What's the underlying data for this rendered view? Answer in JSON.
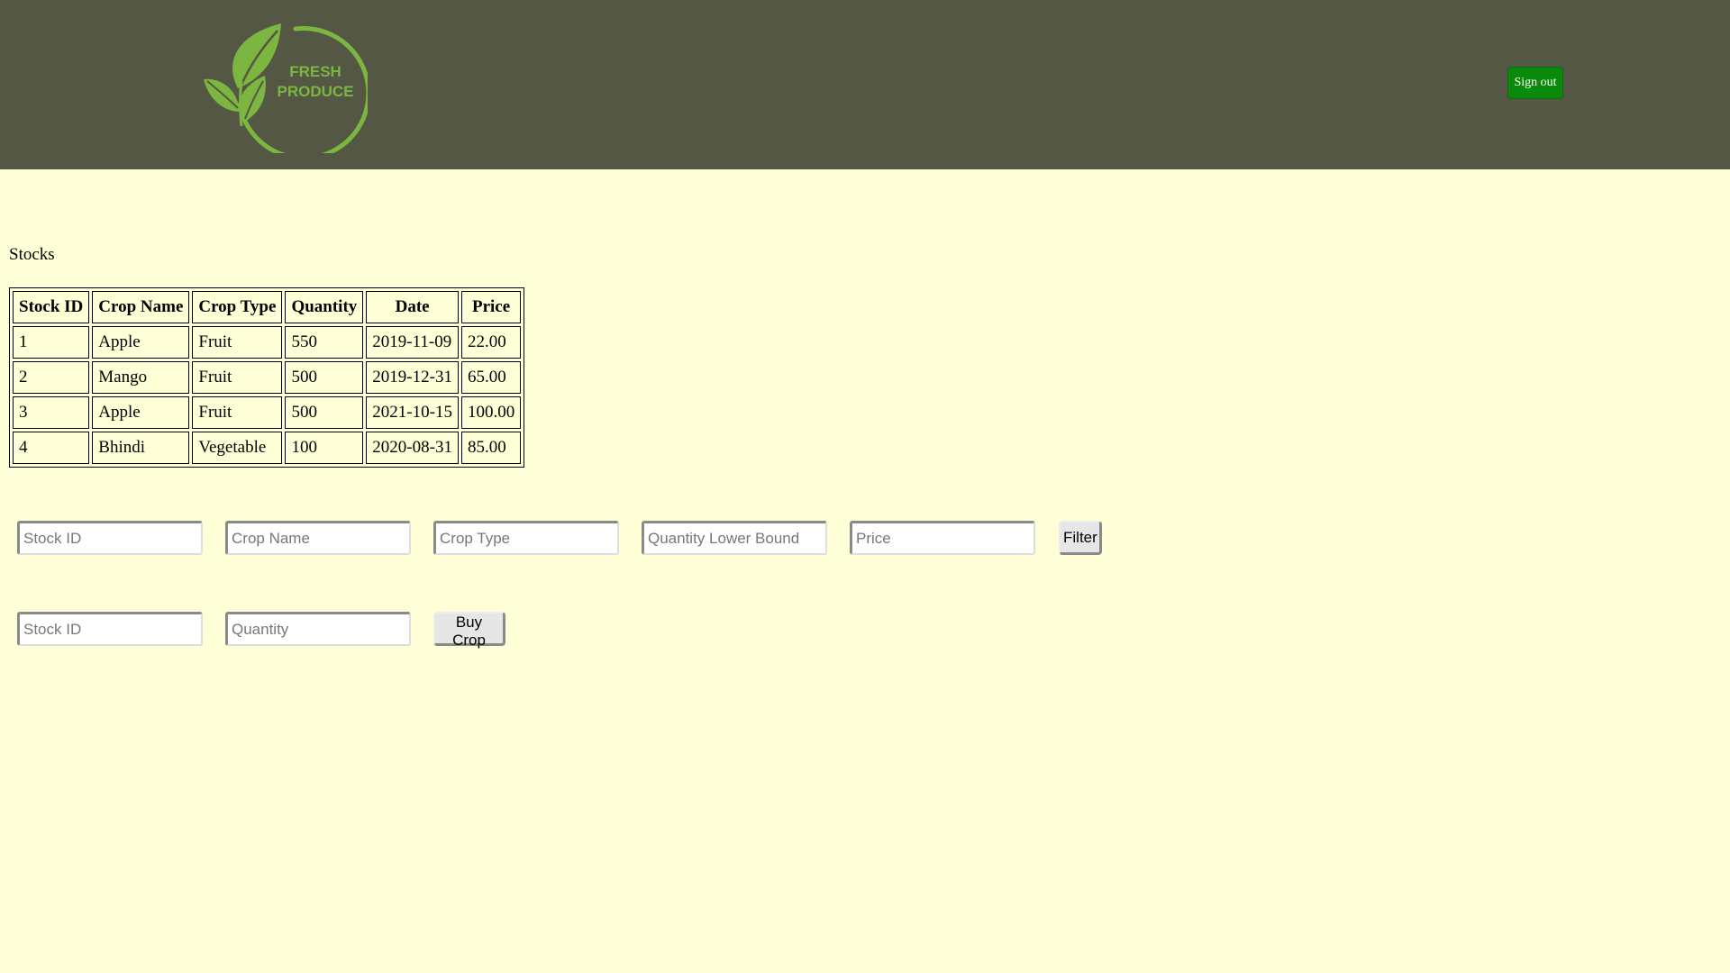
{
  "header": {
    "logo": {
      "line1": "FRESH",
      "line2": "PRODUCE",
      "color": "#7bb640",
      "background": "#555745"
    },
    "signout_label": "Sign out",
    "signout_color": "#0a8a0a"
  },
  "stocks": {
    "title": "Stocks",
    "columns": [
      "Stock ID",
      "Crop Name",
      "Crop Type",
      "Quantity",
      "Date",
      "Price"
    ],
    "rows": [
      [
        "1",
        "Apple",
        "Fruit",
        "550",
        "2019-11-09",
        "22.00"
      ],
      [
        "2",
        "Mango",
        "Fruit",
        "500",
        "2019-12-31",
        "65.00"
      ],
      [
        "3",
        "Apple",
        "Fruit",
        "500",
        "2021-10-15",
        "100.00"
      ],
      [
        "4",
        "Bhindi",
        "Vegetable",
        "100",
        "2020-08-31",
        "85.00"
      ]
    ]
  },
  "filter_form": {
    "stock_id": {
      "placeholder": "Stock ID",
      "value": ""
    },
    "crop_name": {
      "placeholder": "Crop Name",
      "value": ""
    },
    "crop_type": {
      "placeholder": "Crop Type",
      "value": ""
    },
    "quantity_lower_bound": {
      "placeholder": "Quantity Lower Bound",
      "value": ""
    },
    "price": {
      "placeholder": "Price",
      "value": ""
    },
    "filter_label": "Filter"
  },
  "buy_form": {
    "stock_id": {
      "placeholder": "Stock ID",
      "value": ""
    },
    "quantity": {
      "placeholder": "Quantity",
      "value": ""
    },
    "buy_label": "Buy Crop"
  },
  "page_background": "#ffffd7"
}
